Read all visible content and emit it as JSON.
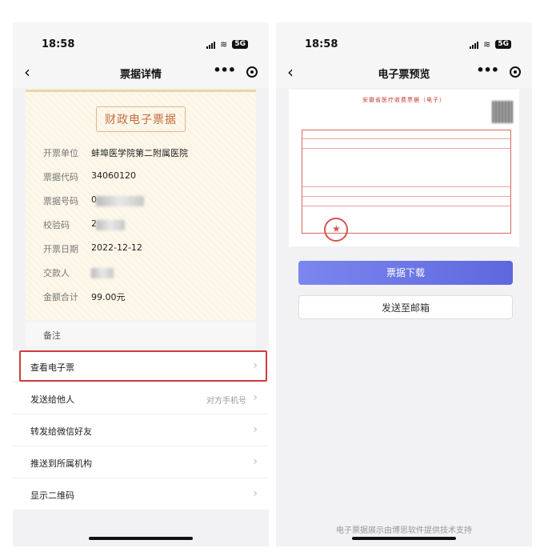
{
  "status_bar": {
    "time": "18:58",
    "battery": "5G"
  },
  "left_screen": {
    "title": "票据详情",
    "ticket": {
      "header": "财政电子票据",
      "rows": [
        {
          "label": "开票单位",
          "value": "蚌埠医学院第二附属医院"
        },
        {
          "label": "票据代码",
          "value": "34060120"
        },
        {
          "label": "票据号码",
          "value": "0"
        },
        {
          "label": "校验码",
          "value": "2"
        },
        {
          "label": "开票日期",
          "value": "2022-12-12"
        },
        {
          "label": "交款人",
          "value": ""
        },
        {
          "label": "金额合计",
          "value": "99.00元"
        }
      ],
      "remark_label": "备注"
    },
    "menu": [
      {
        "label": "查看电子票",
        "hint": ""
      },
      {
        "label": "发送给他人",
        "hint": "对方手机号"
      },
      {
        "label": "转发给微信好友",
        "hint": ""
      },
      {
        "label": "推送到所属机构",
        "hint": ""
      },
      {
        "label": "显示二维码",
        "hint": ""
      }
    ]
  },
  "right_screen": {
    "title": "电子票预览",
    "invoice_header": "安徽省医疗收费票据（电子）",
    "download_label": "票据下载",
    "email_label": "发送至邮箱",
    "footer": "电子票据展示由博思软件提供技术支持"
  }
}
